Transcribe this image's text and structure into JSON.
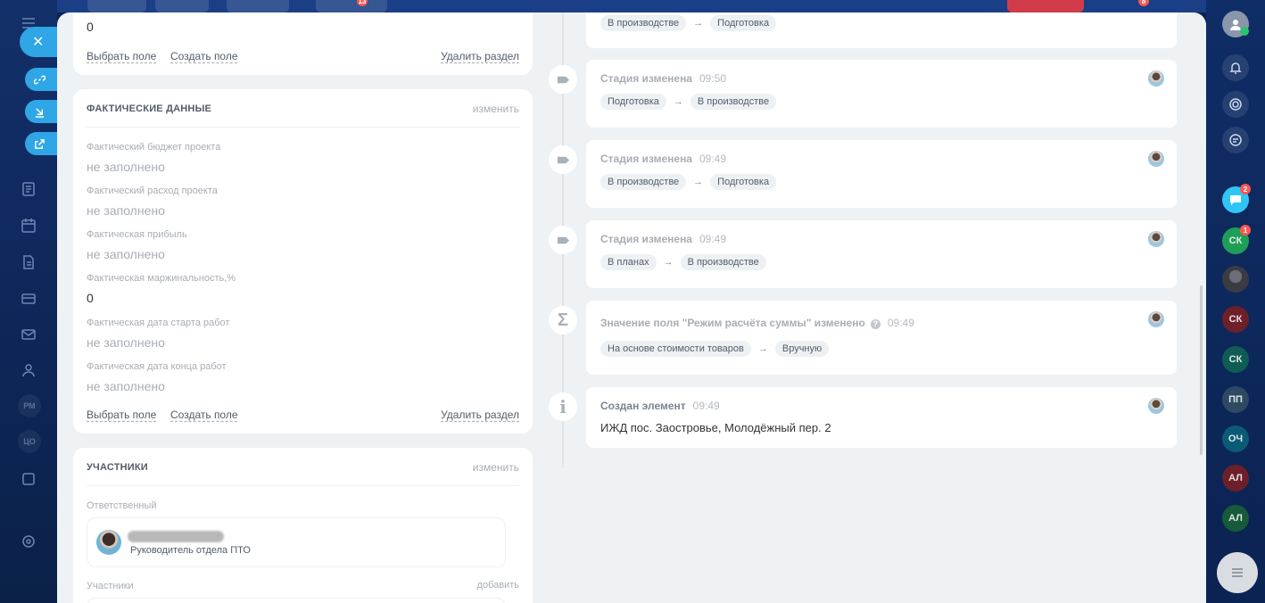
{
  "left_nav": {
    "text_items": [
      "РМ",
      "ЦО"
    ]
  },
  "slider_actions": [
    "close-icon",
    "link-icon",
    "download-icon",
    "open-external-icon"
  ],
  "section_top": {
    "value": "0",
    "select_field": "Выбрать поле",
    "create_field": "Создать поле",
    "delete_section": "Удалить раздел"
  },
  "section_actual": {
    "title": "ФАКТИЧЕСКИЕ ДАННЫЕ",
    "edit": "изменить",
    "fields": [
      {
        "label": "Фактический бюджет проекта",
        "value": "не заполнено"
      },
      {
        "label": "Фактический расход проекта",
        "value": "не заполнено"
      },
      {
        "label": "Фактическая прибыль",
        "value": "не заполнено"
      },
      {
        "label": "Фактическая маржинальность,%",
        "value": "0"
      },
      {
        "label": "Фактическая дата старта работ",
        "value": "не заполнено"
      },
      {
        "label": "Фактическая дата конца работ",
        "value": "не заполнено"
      }
    ],
    "select_field": "Выбрать поле",
    "create_field": "Создать поле",
    "delete_section": "Удалить раздел"
  },
  "section_participants": {
    "title": "УЧАСТНИКИ",
    "edit": "изменить",
    "responsible_label": "Ответственный",
    "responsible_role": "Руководитель отдела ПТО",
    "participants_label": "Участники",
    "add": "добавить"
  },
  "timeline": [
    {
      "type": "stage",
      "title": "",
      "time": "",
      "tags": [
        "В производстве",
        "Подготовка"
      ]
    },
    {
      "type": "stage",
      "title": "Стадия изменена",
      "time": "09:50",
      "tags": [
        "Подготовка",
        "В производстве"
      ]
    },
    {
      "type": "stage",
      "title": "Стадия изменена",
      "time": "09:49",
      "tags": [
        "В производстве",
        "Подготовка"
      ]
    },
    {
      "type": "stage",
      "title": "Стадия изменена",
      "time": "09:49",
      "tags": [
        "В планах",
        "В производстве"
      ]
    },
    {
      "type": "field",
      "title": "Значение поля \"Режим расчёта суммы\" изменено",
      "time": "09:49",
      "tags": [
        "На основе стоимости товаров",
        "Вручную"
      ]
    },
    {
      "type": "created",
      "title": "Создан элемент",
      "time": "09:49",
      "text": "ИЖД пос. Заостровье, Молодёжный пер. 2"
    }
  ],
  "arrow_glyph": "→",
  "right_bar": {
    "icons": [
      "user-avatar",
      "bell-icon",
      "target-icon",
      "chat-icon"
    ],
    "chat_badge": "2",
    "sk_badge": "1",
    "contacts": [
      {
        "initials": "СК",
        "color": "#1f9e57"
      },
      {
        "initials": "",
        "color": "#4b4b55"
      },
      {
        "initials": "СК",
        "color": "#9b2b37"
      },
      {
        "initials": "СК",
        "color": "#137c6b"
      },
      {
        "initials": "ПП",
        "color": "#3c5a74"
      },
      {
        "initials": "ОЧ",
        "color": "#0d6f8c"
      },
      {
        "initials": "АЛ",
        "color": "#8f2a33"
      },
      {
        "initials": "АЛ",
        "color": "#1d6f47"
      }
    ]
  },
  "top_bar": {
    "badge_1": "13",
    "badge_2": "8"
  },
  "colors": {
    "accent": "#2fa6e6",
    "panel_bg": "#eef2f4",
    "badge": "#ff5752"
  }
}
